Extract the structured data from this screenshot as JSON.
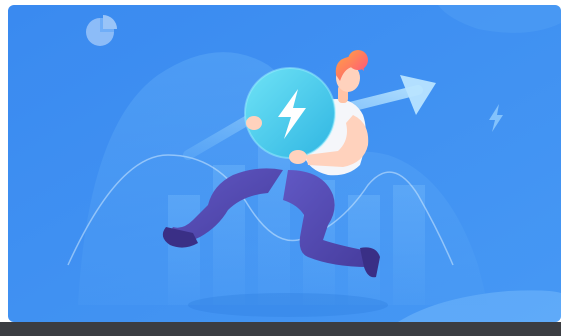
{
  "illustration": {
    "subject": "person-running-with-lightning-orb",
    "icons": [
      "pie-chart-icon",
      "lightning-bolt-icon",
      "trend-up-arrow-icon"
    ],
    "colors": {
      "background": "#3f8ff0",
      "background_light": "#5aa7f6",
      "orb": "#4ad0ee",
      "pants": "#5a4fb9",
      "shirt": "#f5f6fa",
      "hair": "#ff7a50",
      "skin": "#ffd2bd",
      "bottom_bar": "#3b3d42"
    }
  }
}
